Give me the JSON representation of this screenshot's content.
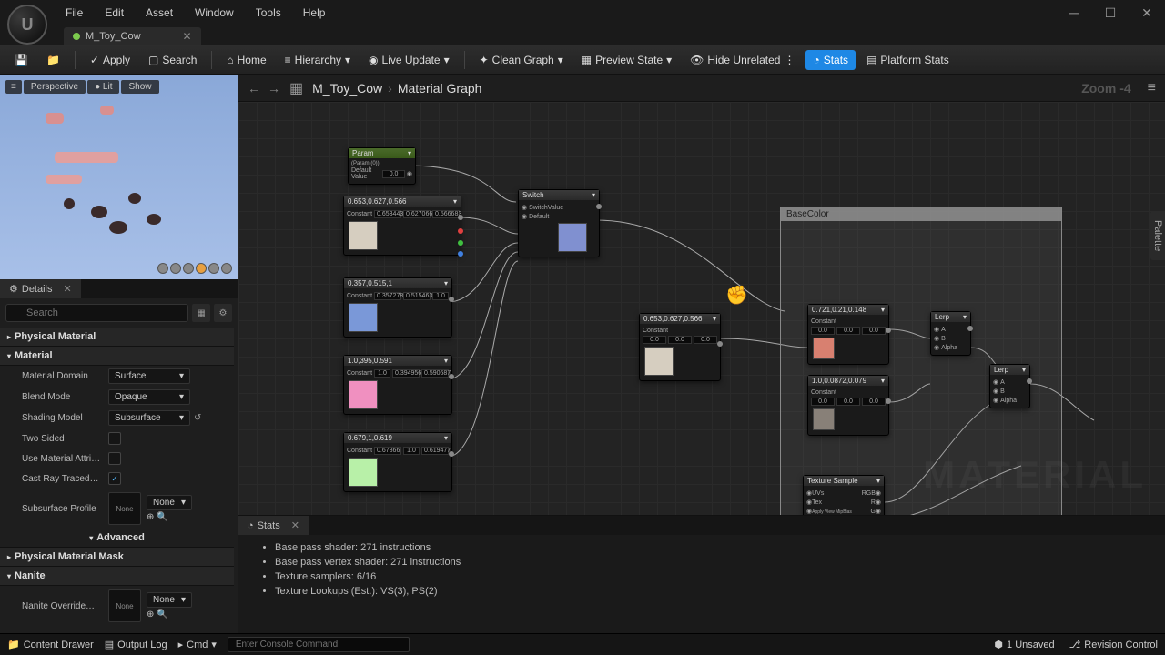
{
  "menu": {
    "file": "File",
    "edit": "Edit",
    "asset": "Asset",
    "window": "Window",
    "tools": "Tools",
    "help": "Help"
  },
  "tab": {
    "name": "M_Toy_Cow"
  },
  "toolbar": {
    "apply": "Apply",
    "search": "Search",
    "home": "Home",
    "hierarchy": "Hierarchy",
    "liveupdate": "Live Update",
    "cleangraph": "Clean Graph",
    "previewstate": "Preview State",
    "hideunrelated": "Hide Unrelated",
    "stats": "Stats",
    "platformstats": "Platform Stats"
  },
  "viewport": {
    "perspective": "Perspective",
    "lit": "Lit",
    "show": "Show"
  },
  "details": {
    "title": "Details",
    "searchPlaceholder": "Search",
    "cat_phys": "Physical Material",
    "cat_mat": "Material",
    "cat_physmask": "Physical Material Mask",
    "cat_nanite": "Nanite",
    "matdomain_l": "Material Domain",
    "matdomain_v": "Surface",
    "blend_l": "Blend Mode",
    "blend_v": "Opaque",
    "shading_l": "Shading Model",
    "shading_v": "Subsurface",
    "twosided_l": "Two Sided",
    "usematattr_l": "Use Material Attri…",
    "castray_l": "Cast Ray Traced…",
    "subsurf_l": "Subsurface Profile",
    "none": "None",
    "advanced": "Advanced",
    "naniteoverride_l": "Nanite Override…"
  },
  "graph": {
    "asset": "M_Toy_Cow",
    "page": "Material Graph",
    "zoom": "Zoom -4",
    "palette": "Palette",
    "watermark": "MATERIAL",
    "comment_basecolor": "BaseColor",
    "nodes": {
      "param": {
        "title": "Param",
        "sub": "(Param (0))",
        "row": "Default Value",
        "val": "0.0"
      },
      "switch": {
        "title": "Switch",
        "row1": "SwitchValue",
        "row2": "Default"
      },
      "const1": {
        "title": "0.653,0.627,0.566",
        "row": "Constant",
        "r": "0.653443",
        "g": "0.627066",
        "b": "0.566683"
      },
      "const2": {
        "title": "0.357,0.515,1",
        "row": "Constant",
        "r": "0.357278",
        "g": "0.515463",
        "b": "1.0"
      },
      "const3": {
        "title": "1.0,395,0.591",
        "row": "Constant",
        "r": "1.0",
        "g": "0.394956",
        "b": "0.590687"
      },
      "const4": {
        "title": "0.679,1,0.619",
        "row": "Constant",
        "r": "0.67866",
        "g": "1.0",
        "b": "0.619477"
      },
      "const5": {
        "title": "0.653,0.627,0.566",
        "row": "Constant",
        "r": "0.0",
        "g": "0.0",
        "b": "0.0"
      },
      "const6": {
        "title": "0.721,0.21,0.148",
        "row": "Constant",
        "r": "0.0",
        "g": "0.0",
        "b": "0.0"
      },
      "const7": {
        "title": "1.0,0.0872,0.079",
        "row": "Constant",
        "r": "0.0",
        "g": "0.0",
        "b": "0.0"
      },
      "lerp1": {
        "title": "Lerp",
        "a": "A",
        "b": "B",
        "alpha": "Alpha"
      },
      "lerp2": {
        "title": "Lerp",
        "a": "A",
        "b": "B",
        "alpha": "Alpha"
      },
      "tex": {
        "title": "Texture Sample",
        "uvs": "UVs",
        "tex_l": "Tex",
        "view": "Apply View MipBias",
        "rgb": "RGB",
        "r": "R",
        "g": "G"
      }
    }
  },
  "stats": {
    "title": "Stats",
    "lines": [
      "Base pass shader: 271 instructions",
      "Base pass vertex shader: 271 instructions",
      "Texture samplers: 6/16",
      "Texture Lookups (Est.): VS(3), PS(2)"
    ]
  },
  "bottom": {
    "drawer": "Content Drawer",
    "output": "Output Log",
    "cmd": "Cmd",
    "consolePlaceholder": "Enter Console Command",
    "unsaved": "1 Unsaved",
    "revision": "Revision Control"
  }
}
